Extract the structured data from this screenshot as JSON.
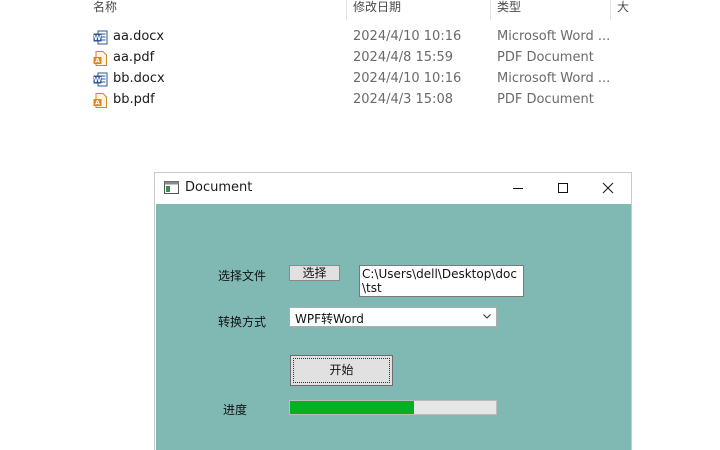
{
  "explorer": {
    "columns": {
      "name": "名称",
      "modified": "修改日期",
      "type": "类型",
      "size": "大"
    },
    "files": [
      {
        "name": "aa.docx",
        "modified": "2024/4/10 10:16",
        "type": "Microsoft Word ...",
        "icon": "word-doc-icon"
      },
      {
        "name": "aa.pdf",
        "modified": "2024/4/8 15:59",
        "type": "PDF Document",
        "icon": "pdf-doc-icon"
      },
      {
        "name": "bb.docx",
        "modified": "2024/4/10 10:16",
        "type": "Microsoft Word ...",
        "icon": "word-doc-icon"
      },
      {
        "name": "bb.pdf",
        "modified": "2024/4/3 15:08",
        "type": "PDF Document",
        "icon": "pdf-doc-icon"
      }
    ]
  },
  "window": {
    "title": "Document",
    "client_bg": "#80b8b4",
    "file_label": "选择文件",
    "choose_button": "选择",
    "path_value": "C:\\Users\\dell\\Desktop\\doc\\tst",
    "mode_label": "转换方式",
    "mode_value": "WPF转Word",
    "start_button": "开始",
    "progress_label": "进度",
    "progress_value": 0.6,
    "progress_color": "#06b025"
  }
}
